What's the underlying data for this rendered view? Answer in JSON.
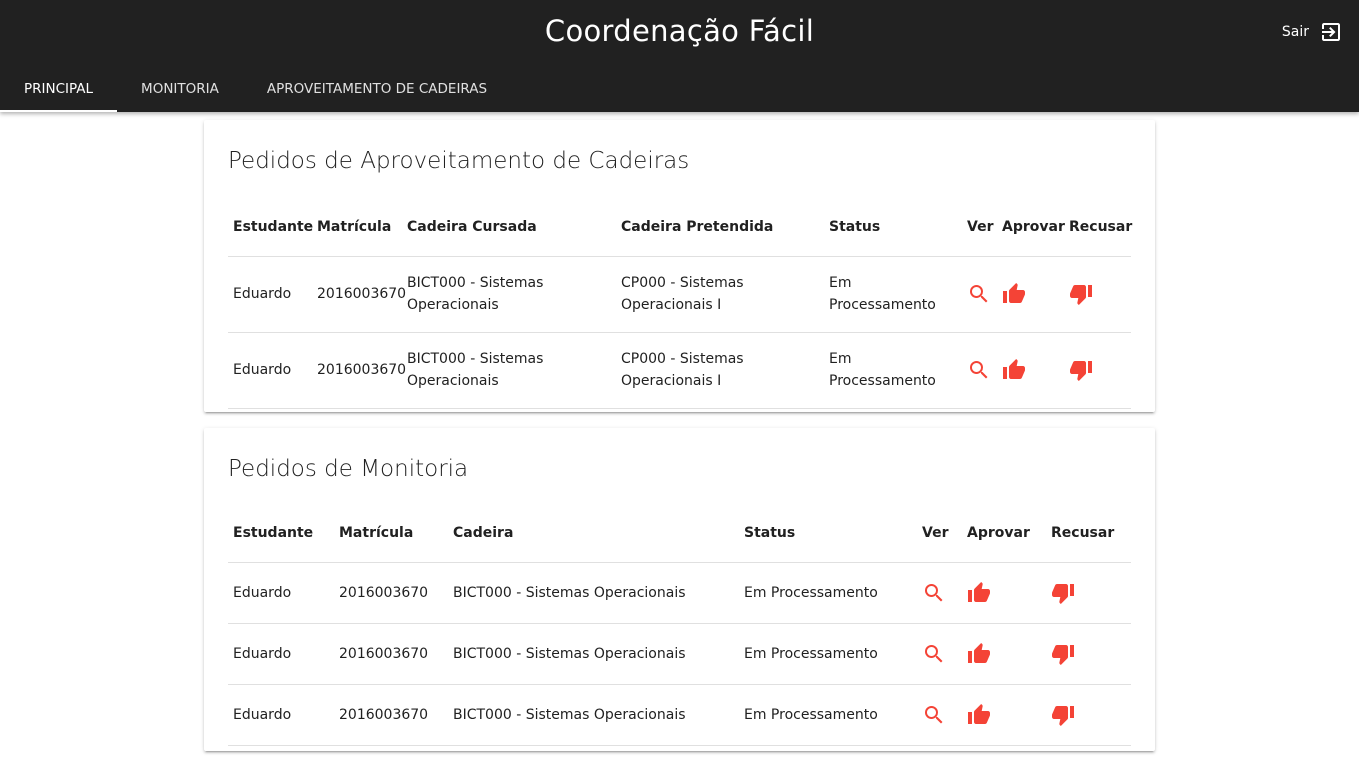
{
  "app": {
    "title": "Coordenação Fácil",
    "logout_label": "Sair",
    "accent_color": "#f44336",
    "bar_color": "#212121"
  },
  "tabs": [
    {
      "label": "Principal",
      "active": true
    },
    {
      "label": "Monitoria",
      "active": false
    },
    {
      "label": "Aproveitamento de Cadeiras",
      "active": false
    }
  ],
  "aproveitamento": {
    "title": "Pedidos de Aproveitamento de Cadeiras",
    "headers": {
      "estudante": "Estudante",
      "matricula": "Matrícula",
      "cadeira_cursada": "Cadeira Cursada",
      "cadeira_pretendida": "Cadeira Pretendida",
      "status": "Status",
      "ver": "Ver",
      "aprovar": "Aprovar",
      "recusar": "Recusar"
    },
    "rows": [
      {
        "estudante": "Eduardo",
        "matricula": "2016003670",
        "cadeira_cursada": "BICT000 - Sistemas Operacionais",
        "cadeira_pretendida": "CP000 - Sistemas Operacionais I",
        "status": "Em Processamento"
      },
      {
        "estudante": "Eduardo",
        "matricula": "2016003670",
        "cadeira_cursada": "BICT000 - Sistemas Operacionais",
        "cadeira_pretendida": "CP000 - Sistemas Operacionais I",
        "status": "Em Processamento"
      }
    ]
  },
  "monitoria": {
    "title": "Pedidos de Monitoria",
    "headers": {
      "estudante": "Estudante",
      "matricula": "Matrícula",
      "cadeira": "Cadeira",
      "status": "Status",
      "ver": "Ver",
      "aprovar": "Aprovar",
      "recusar": "Recusar"
    },
    "rows": [
      {
        "estudante": "Eduardo",
        "matricula": "2016003670",
        "cadeira": "BICT000 - Sistemas Operacionais",
        "status": "Em Processamento"
      },
      {
        "estudante": "Eduardo",
        "matricula": "2016003670",
        "cadeira": "BICT000 - Sistemas Operacionais",
        "status": "Em Processamento"
      },
      {
        "estudante": "Eduardo",
        "matricula": "2016003670",
        "cadeira": "BICT000 - Sistemas Operacionais",
        "status": "Em Processamento"
      }
    ]
  },
  "icons": {
    "view": "search-icon",
    "approve": "thumb-up-icon",
    "refuse": "thumb-down-icon",
    "logout": "exit-to-app-icon"
  }
}
